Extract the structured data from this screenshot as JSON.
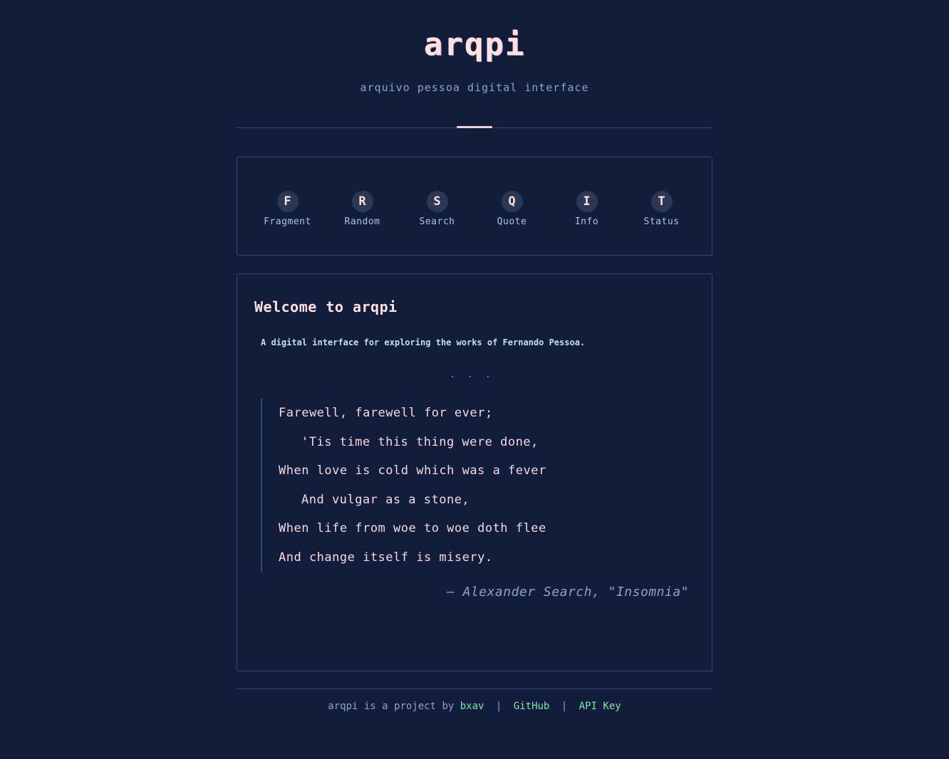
{
  "header": {
    "logo": "arqpi",
    "subtitle": "arquivo pessoa digital interface"
  },
  "nav": {
    "items": [
      {
        "key": "F",
        "label": "Fragment"
      },
      {
        "key": "R",
        "label": "Random"
      },
      {
        "key": "S",
        "label": "Search"
      },
      {
        "key": "Q",
        "label": "Quote"
      },
      {
        "key": "I",
        "label": "Info"
      },
      {
        "key": "T",
        "label": "Status"
      }
    ]
  },
  "welcome": {
    "title": "Welcome to arqpi",
    "description": "A digital interface for exploring the works of Fernando Pessoa.",
    "ellipsis": ". . .",
    "poem": [
      {
        "text": "Farewell, farewell for ever;",
        "indent": false
      },
      {
        "text": "'Tis time this thing were done,",
        "indent": true
      },
      {
        "text": "When love is cold which was a fever",
        "indent": false
      },
      {
        "text": "And vulgar as a stone,",
        "indent": true
      },
      {
        "text": "When life from woe to woe doth flee",
        "indent": false
      },
      {
        "text": "And change itself is misery.",
        "indent": false
      }
    ],
    "attribution": "— Alexander Search, \"Insomnia\""
  },
  "footer": {
    "prefix": "arqpi is a project by",
    "author_link": "bxav",
    "separator": "|",
    "github_link": "GitHub",
    "api_key_link": "API Key"
  },
  "colors": {
    "background": "#121d3b",
    "accent_pink": "#ffe0e3",
    "link_green": "#7ee7a8",
    "muted_blue": "#8aa4c8",
    "border": "#2f4a76"
  }
}
